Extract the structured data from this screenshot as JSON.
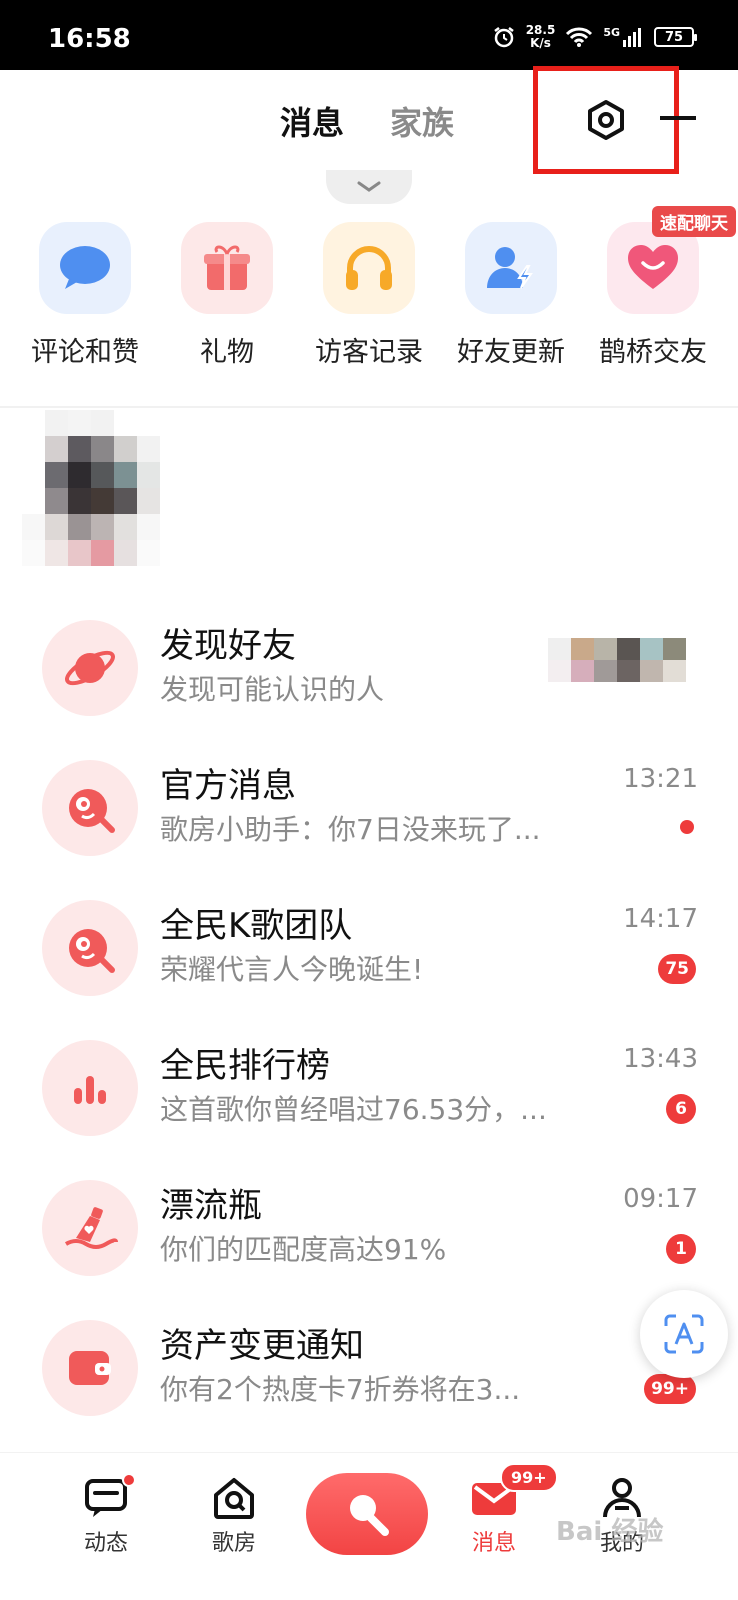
{
  "status_bar": {
    "time": "16:58",
    "speed_value": "28.5",
    "speed_unit": "K/s",
    "network": "5G",
    "battery": "75"
  },
  "header": {
    "tabs": [
      {
        "label": "消息",
        "active": true
      },
      {
        "label": "家族",
        "active": false
      }
    ],
    "highlight_color": "#e8201a"
  },
  "quick_entries": [
    {
      "label": "评论和赞",
      "icon": "comment-bubble-icon"
    },
    {
      "label": "礼物",
      "icon": "gift-icon"
    },
    {
      "label": "访客记录",
      "icon": "headphones-icon"
    },
    {
      "label": "好友更新",
      "icon": "friend-update-icon"
    },
    {
      "label": "鹊桥交友",
      "icon": "heart-icon",
      "badge": "速配聊天"
    }
  ],
  "messages": [
    {
      "title": "发现好友",
      "subtitle": "发现可能认识的人",
      "icon": "planet-icon"
    },
    {
      "title": "官方消息",
      "subtitle": "歌房小助手：你7日没来玩了...",
      "time": "13:21",
      "dot": true,
      "icon": "karaoke-logo-icon"
    },
    {
      "title": "全民K歌团队",
      "subtitle": "荣耀代言人今晚诞生!",
      "time": "14:17",
      "badge": "75",
      "icon": "karaoke-logo-icon"
    },
    {
      "title": "全民排行榜",
      "subtitle": "这首歌你曾经唱过76.53分，...",
      "time": "13:43",
      "badge": "6",
      "icon": "bar-chart-icon"
    },
    {
      "title": "漂流瓶",
      "subtitle": "你们的匹配度高达91%",
      "time": "09:17",
      "badge": "1",
      "icon": "bottle-icon"
    },
    {
      "title": "资产变更通知",
      "subtitle": "你有2个热度卡7折券将在3...",
      "badge": "99+",
      "icon": "wallet-icon"
    }
  ],
  "bottom_nav": [
    {
      "label": "动态",
      "icon": "chat-icon",
      "dot": true
    },
    {
      "label": "歌房",
      "icon": "room-icon"
    },
    {
      "label": "",
      "icon": "microphone-icon"
    },
    {
      "label": "消息",
      "icon": "mail-icon",
      "badge": "99+",
      "active": true
    },
    {
      "label": "我的",
      "icon": "person-icon"
    }
  ],
  "watermark": "Bai 经验",
  "colors": {
    "accent": "#ee3b3b",
    "icon_bg_pink": "#fde8e8",
    "text_secondary": "#8a8a8a"
  }
}
